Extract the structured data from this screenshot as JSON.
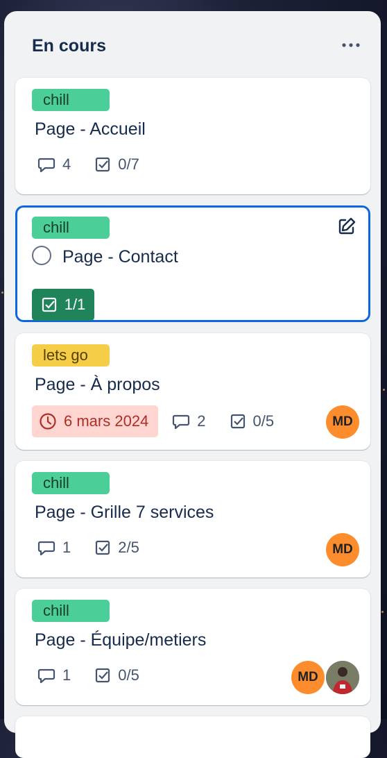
{
  "list": {
    "title": "En cours",
    "more_icon": "ellipsis-icon"
  },
  "cards": [
    {
      "label": "chill",
      "label_color": "#4bce97",
      "title": "Page - Accueil",
      "comments": "4",
      "checklist": "0/7"
    },
    {
      "label": "chill",
      "label_color": "#4bce97",
      "title": "Page - Contact",
      "checklist": "1/1",
      "checklist_complete": true,
      "edit_icon": "edit-icon"
    },
    {
      "label": "lets go",
      "label_color": "#f5cd47",
      "title": "Page - À propos",
      "due_date": "6 mars 2024",
      "due_color": "#ffd5d2",
      "comments": "2",
      "checklist": "0/5",
      "members": [
        "MD"
      ]
    },
    {
      "label": "chill",
      "label_color": "#4bce97",
      "title": "Page - Grille 7 services",
      "comments": "1",
      "checklist": "2/5",
      "members": [
        "MD"
      ]
    },
    {
      "label": "chill",
      "label_color": "#4bce97",
      "title": "Page - Équipe/metiers",
      "comments": "1",
      "checklist": "0/5",
      "members": [
        "MD"
      ]
    }
  ],
  "colors": {
    "accent": "#0c66e4",
    "avatar": "#fd8d2c",
    "checklist_done": "#1f845a"
  }
}
